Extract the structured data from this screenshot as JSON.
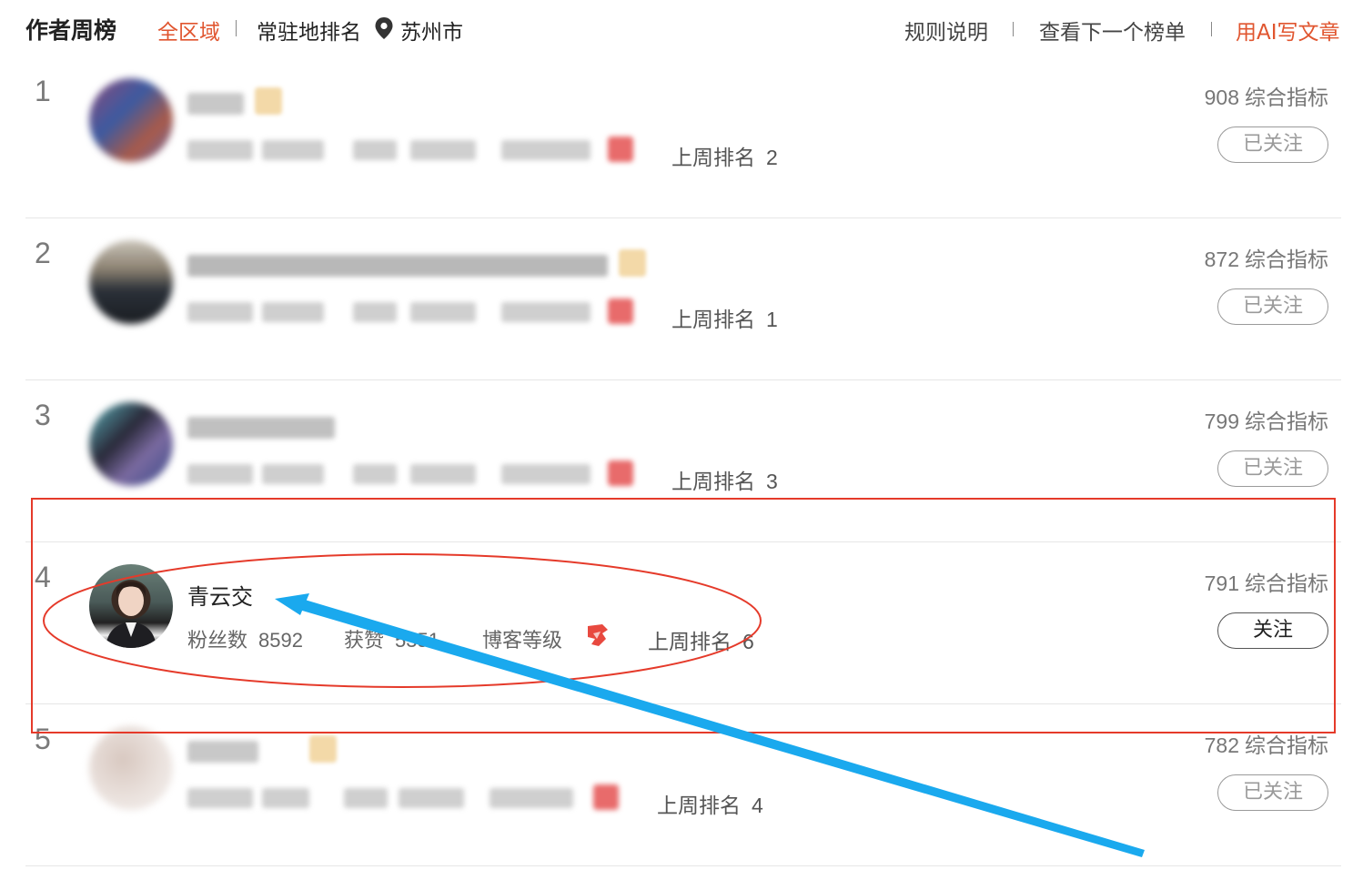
{
  "header": {
    "title": "作者周榜",
    "region_label": "全区域",
    "local_rank_label": "常驻地排名",
    "city": "苏州市",
    "rules_label": "规则说明",
    "next_board_label": "查看下一个榜单",
    "ai_write_label": "用AI写文章"
  },
  "rows": [
    {
      "rank": "1",
      "last_week_label": "上周排名",
      "last_week": "2",
      "score": "908",
      "score_label": "综合指标",
      "follow_label": "已关注"
    },
    {
      "rank": "2",
      "last_week_label": "上周排名",
      "last_week": "1",
      "score": "872",
      "score_label": "综合指标",
      "follow_label": "已关注"
    },
    {
      "rank": "3",
      "last_week_label": "上周排名",
      "last_week": "3",
      "score": "799",
      "score_label": "综合指标",
      "follow_label": "已关注"
    },
    {
      "rank": "4",
      "name": "青云交",
      "fans_label": "粉丝数",
      "fans": "8592",
      "likes_label": "获赞",
      "likes": "5351",
      "level_label": "博客等级",
      "last_week_label": "上周排名",
      "last_week": "6",
      "score": "791",
      "score_label": "综合指标",
      "follow_label": "关注"
    },
    {
      "rank": "5",
      "last_week_label": "上周排名",
      "last_week": "4",
      "score": "782",
      "score_label": "综合指标",
      "follow_label": "已关注"
    }
  ],
  "colors": {
    "accent": "#e0552f",
    "highlight_box": "#e53a2a",
    "arrow": "#1aa9ee"
  }
}
